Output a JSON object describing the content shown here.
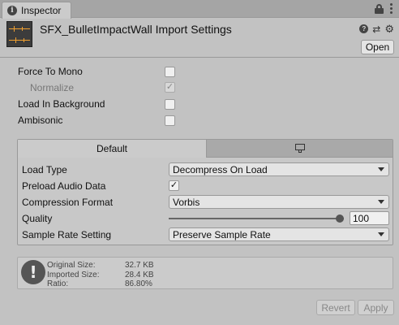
{
  "tab": {
    "title": "Inspector",
    "icon": "info-icon"
  },
  "header": {
    "title": "SFX_BulletImpactWall Import Settings",
    "open_label": "Open"
  },
  "settings": {
    "force_to_mono": {
      "label": "Force To Mono",
      "checked": false
    },
    "normalize": {
      "label": "Normalize",
      "checked": true,
      "disabled": true
    },
    "load_in_background": {
      "label": "Load In Background",
      "checked": false
    },
    "ambisonic": {
      "label": "Ambisonic",
      "checked": false
    }
  },
  "platform": {
    "tabs": [
      {
        "label": "Default",
        "active": true
      },
      {
        "label": "",
        "icon": "monitor-icon",
        "active": false
      }
    ],
    "load_type": {
      "label": "Load Type",
      "value": "Decompress On Load"
    },
    "preload_audio_data": {
      "label": "Preload Audio Data",
      "checked": true
    },
    "compression_format": {
      "label": "Compression Format",
      "value": "Vorbis"
    },
    "quality": {
      "label": "Quality",
      "value": "100",
      "fraction": 1.0
    },
    "sample_rate_setting": {
      "label": "Sample Rate Setting",
      "value": "Preserve Sample Rate"
    }
  },
  "info": {
    "original_size": {
      "label": "Original Size:",
      "value": "32.7 KB"
    },
    "imported_size": {
      "label": "Imported Size:",
      "value": "28.4 KB"
    },
    "ratio": {
      "label": "Ratio:",
      "value": "86.80%"
    }
  },
  "footer": {
    "revert_label": "Revert",
    "apply_label": "Apply"
  }
}
